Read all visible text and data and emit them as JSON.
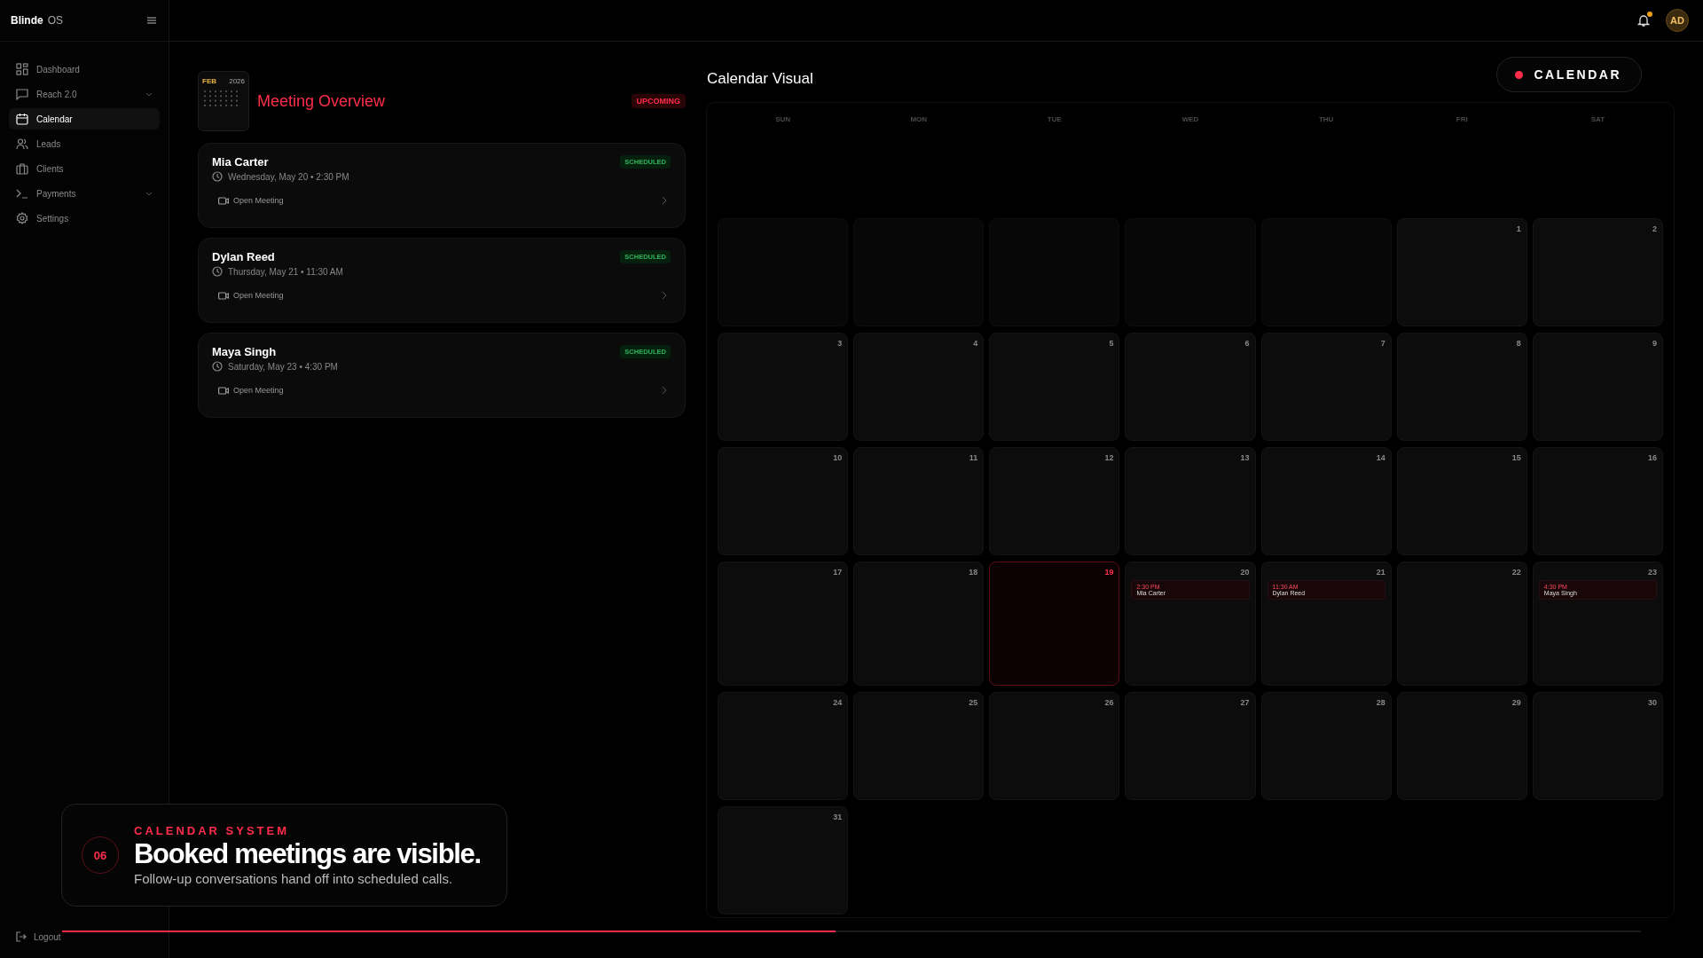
{
  "app": {
    "brand": "Blinde",
    "brand_suffix": "OS"
  },
  "sidebar": {
    "items": [
      {
        "label": "Dashboard",
        "selected": false,
        "has_submenu": false
      },
      {
        "label": "Reach 2.0",
        "selected": false,
        "has_submenu": true
      },
      {
        "label": "Calendar",
        "selected": true,
        "has_submenu": false
      },
      {
        "label": "Leads",
        "selected": false,
        "has_submenu": false
      },
      {
        "label": "Clients",
        "selected": false,
        "has_submenu": false
      },
      {
        "label": "Payments",
        "selected": false,
        "has_submenu": true
      },
      {
        "label": "Settings",
        "selected": false,
        "has_submenu": false
      }
    ],
    "logout": "Logout"
  },
  "topbar": {
    "unread": true,
    "avatar": "AD"
  },
  "overview": {
    "thumb_month": "FEB",
    "thumb_year": "2026",
    "title": "Meeting Overview",
    "badge": "UPCOMING",
    "meetings": [
      {
        "name": "Mia Carter",
        "when": "Wednesday, May 20 • 2:30 PM",
        "status": "SCHEDULED",
        "action": "Open Meeting"
      },
      {
        "name": "Dylan Reed",
        "when": "Thursday, May 21 • 11:30 AM",
        "status": "SCHEDULED",
        "action": "Open Meeting"
      },
      {
        "name": "Maya Singh",
        "when": "Saturday, May 23 • 4:30 PM",
        "status": "SCHEDULED",
        "action": "Open Meeting"
      }
    ]
  },
  "calendar": {
    "title": "Calendar Visual",
    "button": "CALENDAR",
    "weekdays": [
      "SUN",
      "MON",
      "TUE",
      "WED",
      "THU",
      "FRI",
      "SAT"
    ],
    "cells": [
      {
        "kind": "blank"
      },
      {
        "kind": "blank"
      },
      {
        "kind": "blank"
      },
      {
        "kind": "blank"
      },
      {
        "kind": "blank"
      },
      {
        "kind": "day",
        "day": "1",
        "selected": false
      },
      {
        "kind": "day",
        "day": "2",
        "selected": false
      },
      {
        "kind": "day",
        "day": "3",
        "selected": false
      },
      {
        "kind": "day",
        "day": "4",
        "selected": false
      },
      {
        "kind": "day",
        "day": "5",
        "selected": false
      },
      {
        "kind": "day",
        "day": "6",
        "selected": false
      },
      {
        "kind": "day",
        "day": "7",
        "selected": false
      },
      {
        "kind": "day",
        "day": "8",
        "selected": false
      },
      {
        "kind": "day",
        "day": "9",
        "selected": false
      },
      {
        "kind": "day",
        "day": "10",
        "selected": false
      },
      {
        "kind": "day",
        "day": "11",
        "selected": false
      },
      {
        "kind": "day",
        "day": "12",
        "selected": false
      },
      {
        "kind": "day",
        "day": "13",
        "selected": false
      },
      {
        "kind": "day",
        "day": "14",
        "selected": false
      },
      {
        "kind": "day",
        "day": "15",
        "selected": false
      },
      {
        "kind": "day",
        "day": "16",
        "selected": false
      },
      {
        "kind": "day",
        "day": "17",
        "selected": false
      },
      {
        "kind": "day",
        "day": "18",
        "selected": false
      },
      {
        "kind": "day",
        "day": "19",
        "selected": true
      },
      {
        "kind": "day",
        "day": "20",
        "selected": false,
        "events": [
          {
            "time": "2:30 PM",
            "name": "Mia Carter"
          }
        ]
      },
      {
        "kind": "day",
        "day": "21",
        "selected": false,
        "events": [
          {
            "time": "11:30 AM",
            "name": "Dylan Reed"
          }
        ]
      },
      {
        "kind": "day",
        "day": "22",
        "selected": false
      },
      {
        "kind": "day",
        "day": "23",
        "selected": false,
        "events": [
          {
            "time": "4:30 PM",
            "name": "Maya Singh"
          }
        ]
      },
      {
        "kind": "day",
        "day": "24",
        "selected": false
      },
      {
        "kind": "day",
        "day": "25",
        "selected": false
      },
      {
        "kind": "day",
        "day": "26",
        "selected": false
      },
      {
        "kind": "day",
        "day": "27",
        "selected": false
      },
      {
        "kind": "day",
        "day": "28",
        "selected": false
      },
      {
        "kind": "day",
        "day": "29",
        "selected": false
      },
      {
        "kind": "day",
        "day": "30",
        "selected": false
      },
      {
        "kind": "day",
        "day": "31",
        "selected": false
      }
    ]
  },
  "caption": {
    "number": "06",
    "eyebrow": "CALENDAR SYSTEM",
    "headline": "Booked meetings are visible.",
    "subtext": "Follow-up conversations hand off into scheduled calls."
  },
  "progress": {
    "level": 0.49
  }
}
